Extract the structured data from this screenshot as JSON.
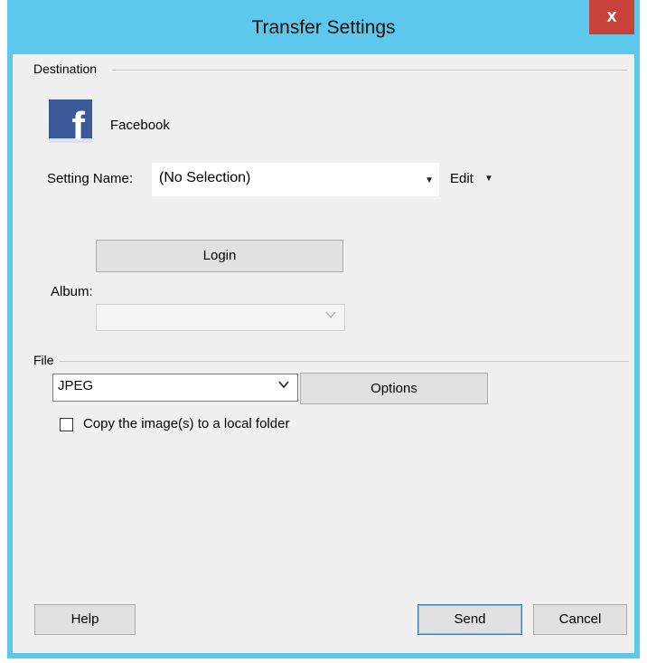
{
  "window": {
    "title": "Transfer Settings",
    "close_glyph": "x"
  },
  "destination": {
    "group_label": "Destination",
    "service_name": "Facebook",
    "service_icon": "facebook-icon",
    "icon_letter": "f",
    "setting_name_label": "Setting Name:",
    "setting_name_value": "(No Selection)",
    "edit_label": "Edit",
    "login_label": "Login",
    "album_label": "Album:",
    "album_value": ""
  },
  "file": {
    "group_label": "File",
    "format_value": "JPEG",
    "options_label": "Options",
    "copy_checkbox_label": "Copy the image(s) to a local folder",
    "copy_checked": false
  },
  "footer": {
    "help_label": "Help",
    "send_label": "Send",
    "cancel_label": "Cancel"
  },
  "colors": {
    "titlebar": "#5bc8ec",
    "close_button": "#c8423a",
    "facebook_blue": "#3b5998",
    "dialog_background": "#f0f0f0",
    "default_button_border": "#3c7fb1"
  }
}
